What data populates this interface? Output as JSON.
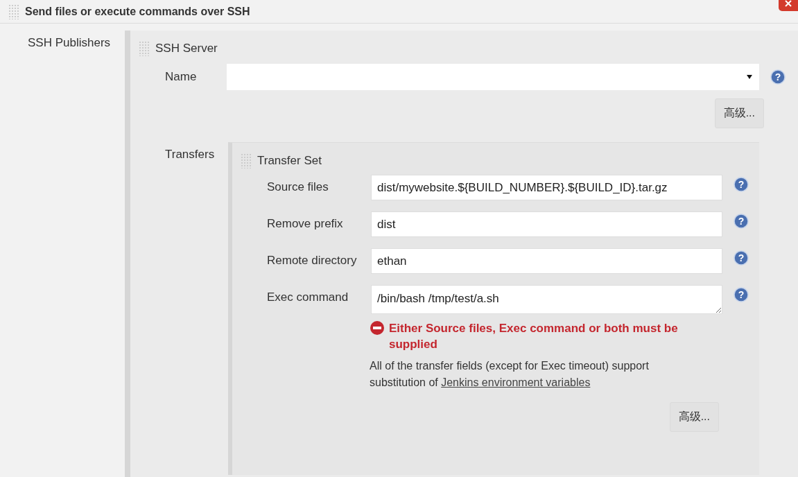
{
  "section": {
    "title": "Send files or execute commands over SSH"
  },
  "publishers": {
    "label": "SSH Publishers",
    "server": {
      "title": "SSH Server",
      "name_label": "Name",
      "name_help": "?",
      "advanced_button": "高级...",
      "transfers_label": "Transfers",
      "transfer_set": {
        "title": "Transfer Set",
        "fields": [
          {
            "kind": "input",
            "label": "Source files",
            "value": "dist/mywebsite.${BUILD_NUMBER}.${BUILD_ID}.tar.gz",
            "help": "?"
          },
          {
            "kind": "input",
            "label": "Remove prefix",
            "value": "dist",
            "help": "?"
          },
          {
            "kind": "input",
            "label": "Remote directory",
            "value": "ethan",
            "help": "?"
          },
          {
            "kind": "textarea",
            "label": "Exec command",
            "value": "/bin/bash /tmp/test/a.sh",
            "help": "?"
          }
        ],
        "error": "Either Source files, Exec command or both must be supplied",
        "note": "All of the transfer fields (except for Exec timeout) support substitution of",
        "note_link": "Jenkins environment variables",
        "advanced_button": "高级..."
      }
    }
  }
}
